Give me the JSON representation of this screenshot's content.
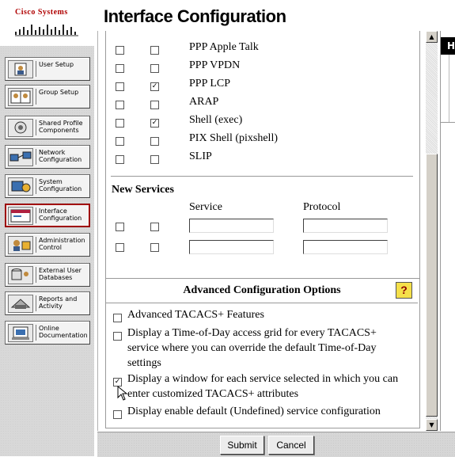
{
  "brand": {
    "name": "Cisco Systems"
  },
  "page": {
    "title": "Interface Configuration"
  },
  "nav": [
    {
      "label": "User Setup",
      "icon": "user-icon"
    },
    {
      "label": "Group Setup",
      "icon": "group-icon"
    },
    {
      "label": "Shared Profile Components",
      "icon": "shared-profile-icon"
    },
    {
      "label": "Network Configuration",
      "icon": "network-icon"
    },
    {
      "label": "System Configuration",
      "icon": "system-icon"
    },
    {
      "label": "Interface Configuration",
      "icon": "interface-icon",
      "selected": true
    },
    {
      "label": "Administration Control",
      "icon": "admin-icon"
    },
    {
      "label": "External User Databases",
      "icon": "database-icon"
    },
    {
      "label": "Reports and Activity",
      "icon": "reports-icon"
    },
    {
      "label": "Online Documentation",
      "icon": "documentation-icon"
    }
  ],
  "services": [
    {
      "name": "PPP Apple Talk",
      "user": false,
      "group": false
    },
    {
      "name": "PPP VPDN",
      "user": false,
      "group": false
    },
    {
      "name": "PPP LCP",
      "user": false,
      "group": true
    },
    {
      "name": "ARAP",
      "user": false,
      "group": false
    },
    {
      "name": "Shell (exec)",
      "user": false,
      "group": true
    },
    {
      "name": "PIX Shell (pixshell)",
      "user": false,
      "group": false
    },
    {
      "name": "SLIP",
      "user": false,
      "group": false
    }
  ],
  "new_services": {
    "heading": "New Services",
    "col_service": "Service",
    "col_protocol": "Protocol",
    "rows": [
      {
        "service": "",
        "protocol": ""
      },
      {
        "service": "",
        "protocol": ""
      }
    ]
  },
  "advanced": {
    "heading": "Advanced Configuration Options",
    "help_label": "?",
    "options": [
      {
        "line1": "Advanced TACACS+ Features",
        "line2": "",
        "line3": "",
        "checked": false
      },
      {
        "line1": "Display a Time-of-Day access grid for every TACACS+",
        "line2": "service where you can override the default Time-of-Day",
        "line3": "settings",
        "checked": false
      },
      {
        "line1": "Display a window for each service selected in which you can",
        "line2": "enter customized TACACS+ attributes",
        "line3": "",
        "checked": true
      },
      {
        "line1": "Display enable default (Undefined) service configuration",
        "line2": "",
        "line3": "",
        "checked": false
      }
    ]
  },
  "buttons": {
    "submit": "Submit",
    "cancel": "Cancel"
  },
  "help_frame": {
    "header_initial": "H"
  },
  "scroll": {
    "up": "▲",
    "down": "▼"
  },
  "check_mark": "✓"
}
